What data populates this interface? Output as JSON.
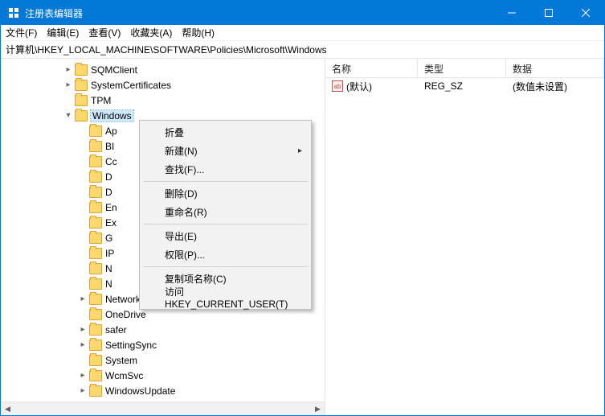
{
  "title": "注册表编辑器",
  "menubar": {
    "file": "文件(F)",
    "edit": "编辑(E)",
    "view": "查看(V)",
    "fav": "收藏夹(A)",
    "help": "帮助(H)"
  },
  "address": "计算机\\HKEY_LOCAL_MACHINE\\SOFTWARE\\Policies\\Microsoft\\Windows",
  "list": {
    "hdr_name": "名称",
    "hdr_type": "类型",
    "hdr_data": "数据",
    "row0_name": "(默认)",
    "row0_type": "REG_SZ",
    "row0_data": "(数值未设置)"
  },
  "tree": {
    "sqm": "SQMClient",
    "syscert": "SystemCertificates",
    "tpm": "TPM",
    "windows": "Windows",
    "ap": "Ap",
    "bi": "BI",
    "cc": "Cc",
    "dd1": "D",
    "dd2": "D",
    "en": "En",
    "ex": "Ex",
    "gp": "G",
    "ip": "IP",
    "nn1": "N",
    "nn2": "N",
    "netprov": "NetworkProvider",
    "onedrive": "OneDrive",
    "safer": "safer",
    "settingsync": "SettingSync",
    "system": "System",
    "wcmsvc": "WcmSvc",
    "winupd": "WindowsUpdate"
  },
  "ctx": {
    "collapse": "折叠",
    "new": "新建(N)",
    "find": "查找(F)...",
    "delete": "删除(D)",
    "rename": "重命名(R)",
    "export": "导出(E)",
    "perm": "权限(P)...",
    "copykey": "复制项名称(C)",
    "gotohkcu": "访问 HKEY_CURRENT_USER(T)"
  }
}
